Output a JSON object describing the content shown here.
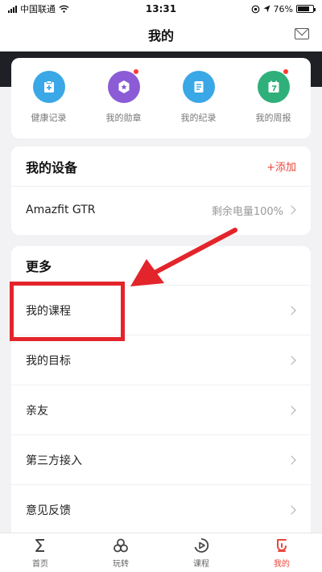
{
  "status_bar": {
    "carrier": "中国联通",
    "time": "13:31",
    "battery_percent": "76%",
    "battery_level": 0.76
  },
  "nav": {
    "title": "我的"
  },
  "shortcuts": [
    {
      "label": "健康记录",
      "icon": "health-record-icon",
      "color": "#3aa7e6",
      "dot": false
    },
    {
      "label": "我的勋章",
      "icon": "medal-icon",
      "color": "#8b5cd6",
      "dot": true
    },
    {
      "label": "我的纪录",
      "icon": "records-icon",
      "color": "#3aa7e6",
      "dot": false
    },
    {
      "label": "我的周报",
      "icon": "weekly-report-icon",
      "color": "#2fb07a",
      "dot": true
    }
  ],
  "devices": {
    "title": "我的设备",
    "add_label": "+添加",
    "device_name": "Amazfit GTR",
    "battery_text": "剩余电量100%"
  },
  "more": {
    "title": "更多",
    "items": [
      {
        "label": "我的课程"
      },
      {
        "label": "我的目标"
      },
      {
        "label": "亲友"
      },
      {
        "label": "第三方接入"
      },
      {
        "label": "意见反馈"
      }
    ]
  },
  "tabs": [
    {
      "label": "首页",
      "icon": "sigma-icon",
      "active": false
    },
    {
      "label": "玩转",
      "icon": "loop-icon",
      "active": false
    },
    {
      "label": "课程",
      "icon": "play-icon",
      "active": false
    },
    {
      "label": "我的",
      "icon": "profile-icon",
      "active": true
    }
  ],
  "colors": {
    "accent": "#e9463a",
    "annotation": "#e3242b",
    "header_band": "#1f2026"
  }
}
